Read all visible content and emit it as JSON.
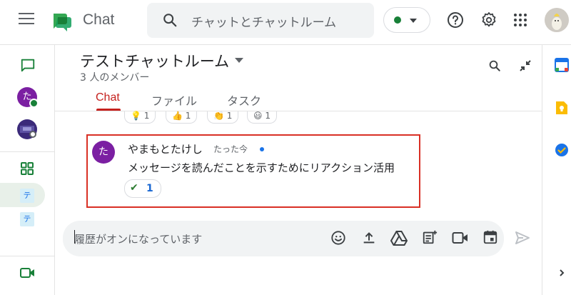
{
  "header": {
    "app_title": "Chat",
    "search_placeholder": "チャットとチャットルーム",
    "status_color": "#188038"
  },
  "left_rail": {
    "avatar1_initial": "た",
    "avatar_chip1": "テ",
    "avatar_chip2": "テ"
  },
  "room": {
    "title": "テストチャットルーム",
    "members": "3 人のメンバー",
    "tabs": [
      "Chat",
      "ファイル",
      "タスク"
    ]
  },
  "prev_reactions": [
    "💡 1",
    "👍 1",
    "👏 1",
    "😃 1"
  ],
  "message": {
    "avatar_initial": "た",
    "sender": "やまもとたけし",
    "time": "たった今",
    "text": "メッセージを読んだことを示すためにリアクション活用",
    "reaction_emoji": "✔",
    "reaction_count": "1"
  },
  "composer": {
    "placeholder": "履歴がオンになっています"
  },
  "colors": {
    "accent_red": "#c5221f",
    "highlight_border": "#d93025",
    "avatar_purple": "#7b1fa2"
  }
}
